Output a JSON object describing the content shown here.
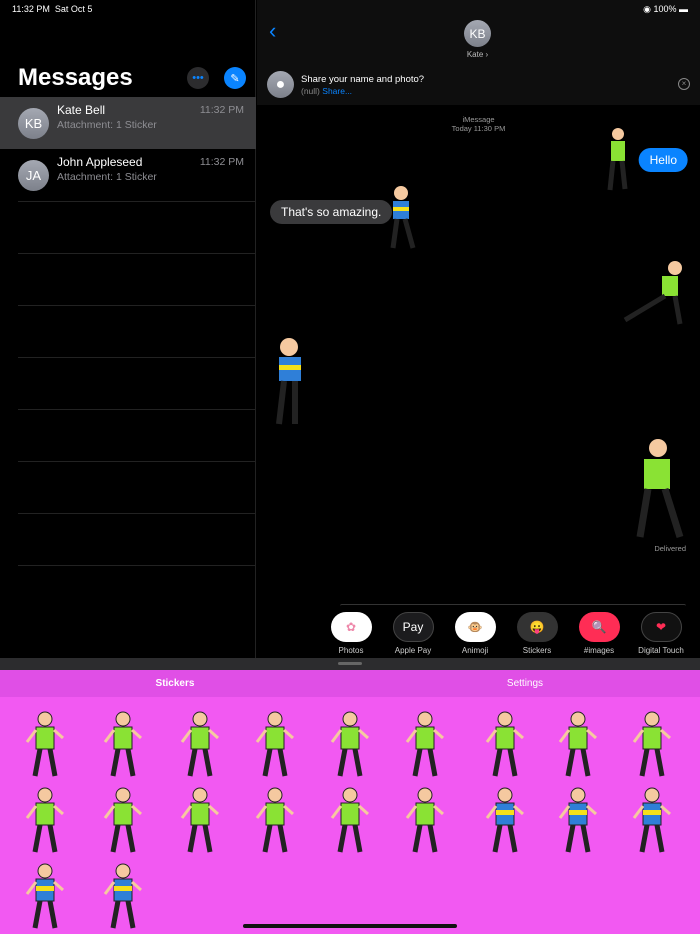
{
  "status": {
    "time": "11:32 PM",
    "date": "Sat Oct 5",
    "battery": "100%"
  },
  "sidebar": {
    "title": "Messages",
    "conversations": [
      {
        "initials": "KB",
        "name": "Kate Bell",
        "preview": "Attachment: 1 Sticker",
        "time": "11:32 PM"
      },
      {
        "initials": "JA",
        "name": "John Appleseed",
        "preview": "Attachment: 1 Sticker",
        "time": "11:32 PM"
      }
    ]
  },
  "header": {
    "initials": "KB",
    "name": "Kate",
    "chevron": "›"
  },
  "share": {
    "title": "Share your name and photo?",
    "null": "(null)",
    "link": "Share..."
  },
  "chat": {
    "service": "iMessage",
    "timestamp": "Today 11:30 PM",
    "sent": "Hello",
    "received": "That's so amazing.",
    "delivered": "Delivered"
  },
  "apps": [
    {
      "label": "Photos",
      "icon": "✿"
    },
    {
      "label": "Apple Pay",
      "icon": "Pay"
    },
    {
      "label": "Animoji",
      "icon": "🐵"
    },
    {
      "label": "Stickers",
      "icon": "😛"
    },
    {
      "label": "#images",
      "icon": "🔍"
    },
    {
      "label": "Digital Touch",
      "icon": "❤"
    }
  ],
  "tabs": {
    "stickers": "Stickers",
    "settings": "Settings"
  },
  "stickers": [
    "girl",
    "girl",
    "girl",
    "girl",
    "girl",
    "girl",
    "girl",
    "girl",
    "girl",
    "girl",
    "girl",
    "girl",
    "girl",
    "girl",
    "girl",
    "boy",
    "boy",
    "boy",
    "boy",
    "boy"
  ],
  "colors": {
    "accent": "#0a84ff",
    "pink": "#f259f2",
    "tab": "#e04fe6"
  }
}
